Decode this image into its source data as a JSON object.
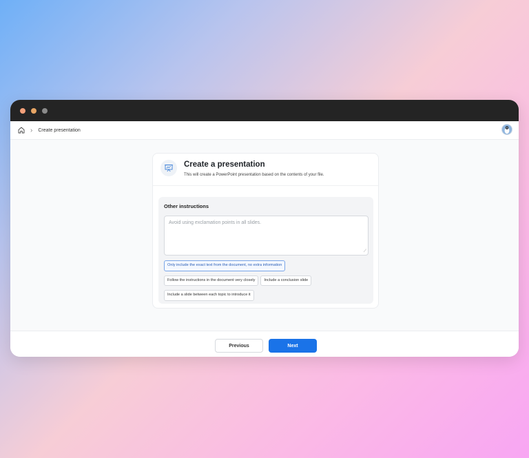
{
  "window": {
    "traffic_lights": [
      "#f4a07a",
      "#e7a565",
      "#8a8a8a"
    ]
  },
  "topbar": {
    "breadcrumb": "Create presentation"
  },
  "card": {
    "title": "Create a presentation",
    "subtitle": "This will create a PowerPoint presentation based on the contents of your file."
  },
  "instructions": {
    "label": "Other instructions",
    "placeholder": "Avoid using exclamation points in all slides.",
    "chips": [
      {
        "label": "Only include the exact text from the document, no extra information",
        "selected": true
      },
      {
        "label": "Follow the instructions in the document very closely",
        "selected": false
      },
      {
        "label": "Include a conclusion slide",
        "selected": false
      },
      {
        "label": "Include a slide between each topic to introduce it",
        "selected": false
      }
    ]
  },
  "footer": {
    "previous_label": "Previous",
    "next_label": "Next"
  },
  "colors": {
    "accent": "#1a73e8"
  }
}
